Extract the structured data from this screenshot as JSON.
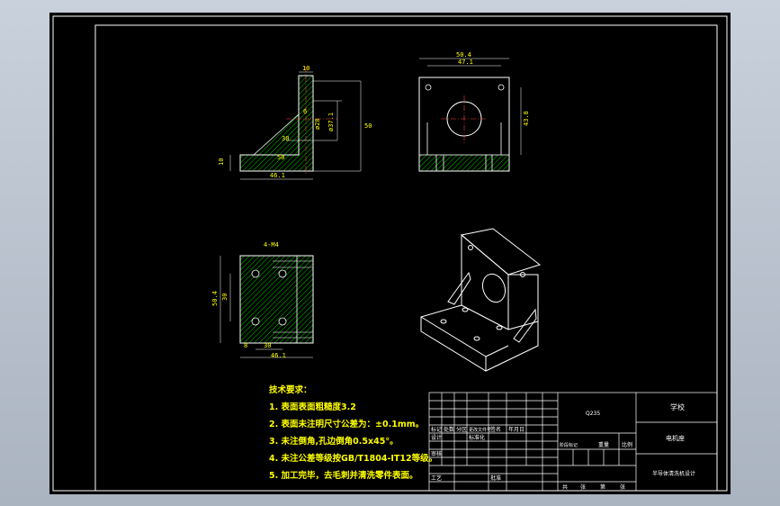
{
  "drawing": {
    "front_view_dims": {
      "top_thickness": "10",
      "height": "50",
      "bore_dia": "ø37.1",
      "hole_dia": "ø28",
      "small": "6",
      "rib": "30",
      "base_thickness": "10",
      "base_len": "50",
      "width": "46.1"
    },
    "side_view_dims": {
      "overall": "50.4",
      "inner": "47.1",
      "height": "43.8"
    },
    "top_view_dims": {
      "holes": "4-M4",
      "height": "50.4",
      "pitch_v": "30",
      "left": "8",
      "pitch_h": "30",
      "width": "46.1"
    },
    "notes": {
      "title": "技术要求：",
      "items": [
        "1. 表面表面粗糙度3.2",
        "2. 表面未注明尺寸公差为：±0.1mm。",
        "3. 未注倒角,孔边倒角0.5x45°。",
        "4. 未注公差等级按GB/T1804-IT12等级。",
        "5. 加工完毕，去毛刺并清洗零件表面。"
      ]
    },
    "title_block": {
      "material": "Q235",
      "school": "学校",
      "part_name": "电机座",
      "project": "半导体清洗机设计",
      "row1": [
        "标记",
        "处数",
        "分区",
        "更改文件号",
        "签名",
        "年月日"
      ],
      "row2": [
        "设计",
        "",
        "标准化",
        "",
        "阶段标记",
        "重量",
        "比例"
      ],
      "row3": [
        "审核",
        "",
        "",
        ""
      ],
      "row4": [
        "工艺",
        "",
        "批准",
        ""
      ],
      "sheet": [
        "共",
        "张",
        "第",
        "张"
      ]
    }
  }
}
